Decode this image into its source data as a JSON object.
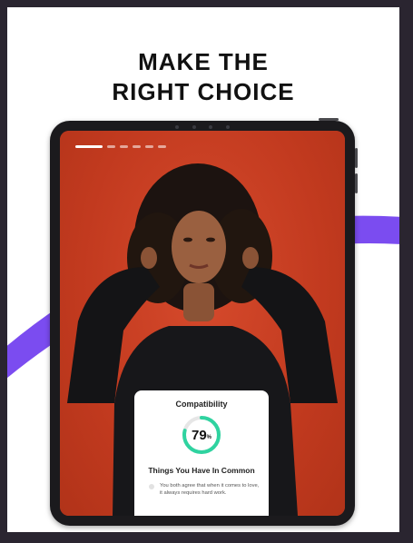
{
  "headline": {
    "line1": "MAKE THE",
    "line2": "RIGHT CHOICE"
  },
  "colors": {
    "band": "#7b4cf0",
    "accent_ring": "#2fd3a0",
    "photo_bg": "#c9391f"
  },
  "story": {
    "segments_total": 6,
    "active_segment": 1
  },
  "compatibility": {
    "title": "Compatibility",
    "percent": 79,
    "value_text": "79",
    "unit": "%",
    "section_title": "Things You Have In Common",
    "items": [
      {
        "text": "You both agree that when it comes to love, it always requires hard work."
      }
    ]
  },
  "icons": {
    "bullet": "dot-icon"
  }
}
